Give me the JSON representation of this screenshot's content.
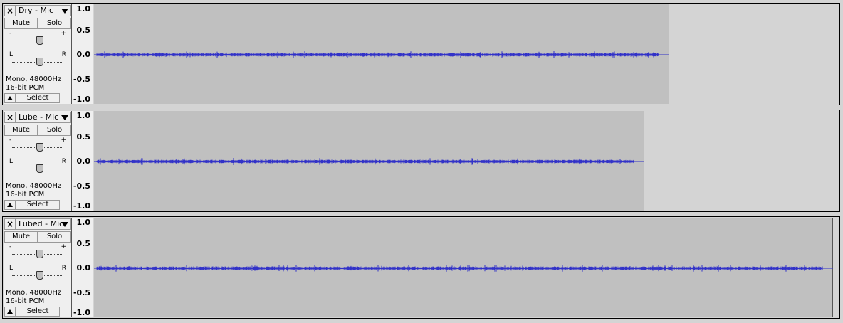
{
  "tracks": [
    {
      "name": "Dry - Mic",
      "mute": "Mute",
      "solo": "Solo",
      "gain_minus": "-",
      "gain_plus": "+",
      "pan_left": "L",
      "pan_right": "R",
      "rate": "Mono, 48000Hz",
      "format": "16-bit PCM",
      "select": "Select",
      "scale": [
        "1.0",
        "0.5",
        "0.0",
        "-0.5",
        "-1.0"
      ]
    },
    {
      "name": "Lube - Mic",
      "mute": "Mute",
      "solo": "Solo",
      "gain_minus": "-",
      "gain_plus": "+",
      "pan_left": "L",
      "pan_right": "R",
      "rate": "Mono, 48000Hz",
      "format": "16-bit PCM",
      "select": "Select",
      "scale": [
        "1.0",
        "0.5",
        "0.0",
        "-0.5",
        "-1.0"
      ]
    },
    {
      "name": "Lubed - Mic",
      "mute": "Mute",
      "solo": "Solo",
      "gain_minus": "-",
      "gain_plus": "+",
      "pan_left": "L",
      "pan_right": "R",
      "rate": "Mono, 48000Hz",
      "format": "16-bit PCM",
      "select": "Select",
      "scale": [
        "1.0",
        "0.5",
        "0.0",
        "-0.5",
        "-1.0"
      ]
    }
  ],
  "colors": {
    "waveform": "#3232c8",
    "clip_bg": "#c0c0c0",
    "empty_bg": "#d4d4d4",
    "panel_bg": "#efefef"
  }
}
